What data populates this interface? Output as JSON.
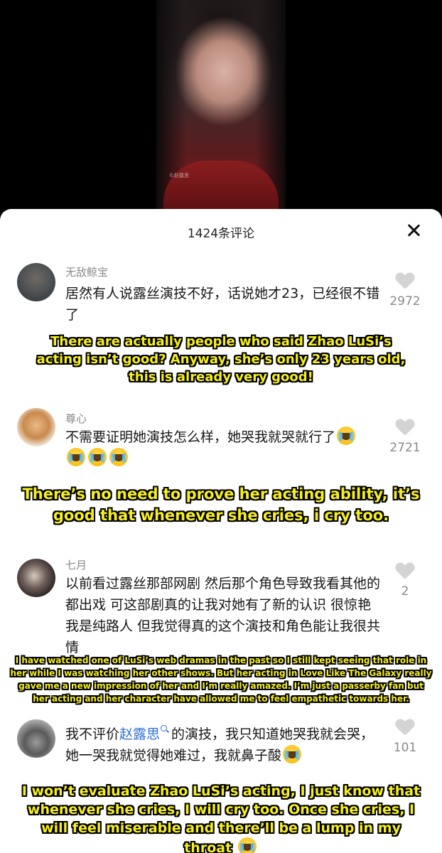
{
  "video": {
    "watermark": "©赵露思"
  },
  "sheet": {
    "comment_count": "1424条评论"
  },
  "comments": [
    {
      "username": "无敌鲸宝",
      "text": "居然有人说露丝演技不好，话说她才23，已经很不错了",
      "likes": "2972",
      "translation": "There are actually people who said Zhao LuSi’s acting isn’t good? Anyway, she’s only 23 years old, this is already very good!"
    },
    {
      "username": "尊心",
      "text": "不需要证明她演技怎么样，她哭我就哭就行了",
      "likes": "2721",
      "translation": "There’s no need to prove her acting ability, it’s good that whenever she cries, i cry too."
    },
    {
      "username": "七月",
      "text": "以前看过露丝那部网剧 然后那个角色导致我看其他的都出戏 可这部剧真的让我对她有了新的认识 很惊艳 我是纯路人 但我觉得真的这个演技和角色能让我很共情",
      "likes": "2",
      "translation": "I have watched one of LuSi’s web dramas in the past so I still kept seeing that role in her while I was watching her other shows. But her acting in Love Like The Galaxy really gave me a new impression of her and I’m really amazed. I’m just a passerby fan but her acting and her character have allowed me to feel empathetic towards her."
    },
    {
      "username": "",
      "text_before": "我不评价",
      "mention": "赵露思",
      "text_after": "的演技，我只知道她哭我就会哭，她一哭我就觉得她难过，我就鼻子酸",
      "likes": "101",
      "translation": "I won’t evaluate Zhao LuSi’s acting, I just know that whenever she cries, I will cry too. Once she cries, I will feel miserable and there’ll be a lump in my throat"
    }
  ],
  "emoji_names": [
    "loudly-crying-face"
  ]
}
